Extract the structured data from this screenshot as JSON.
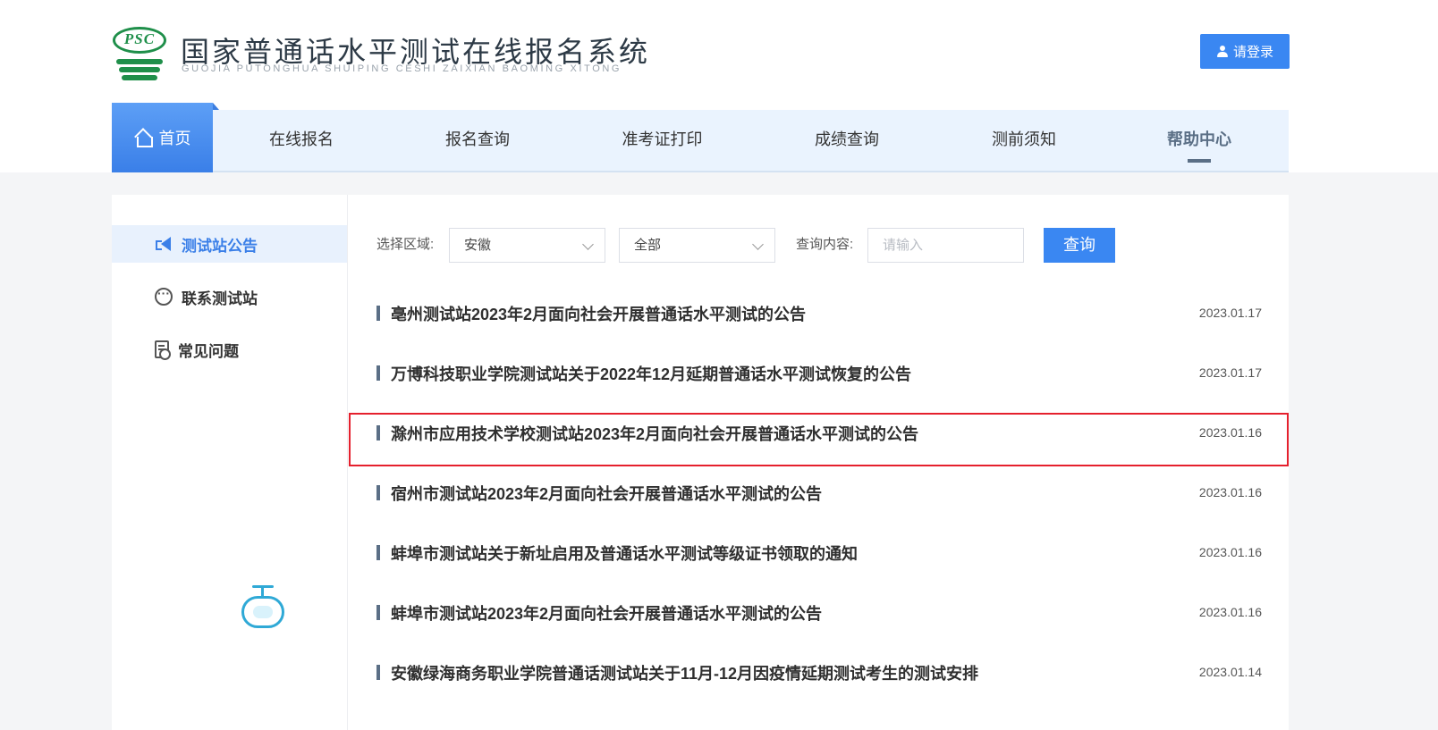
{
  "header": {
    "logo_text": "PSC",
    "site_title": "国家普通话水平测试在线报名系统",
    "site_pinyin": "GUOJIA PUTONGHUA SHUIPING CESHI ZAIXIAN BAOMING XITONG",
    "login_label": "请登录"
  },
  "nav": {
    "items": [
      {
        "label": "首页"
      },
      {
        "label": "在线报名"
      },
      {
        "label": "报名查询"
      },
      {
        "label": "准考证打印"
      },
      {
        "label": "成绩查询"
      },
      {
        "label": "测前须知"
      },
      {
        "label": "帮助中心"
      }
    ],
    "active_index": 6
  },
  "sidebar": {
    "items": [
      {
        "label": "测试站公告",
        "icon": "megaphone-icon"
      },
      {
        "label": "联系测试站",
        "icon": "chat-icon"
      },
      {
        "label": "常见问题",
        "icon": "document-icon"
      }
    ],
    "active_index": 0
  },
  "filters": {
    "region_label": "选择区域:",
    "region_value": "安徽",
    "scope_value": "全部",
    "query_label": "查询内容:",
    "query_placeholder": "请输入",
    "search_button": "查询"
  },
  "news": [
    {
      "title": "亳州测试站2023年2月面向社会开展普通话水平测试的公告",
      "date": "2023.01.17"
    },
    {
      "title": "万博科技职业学院测试站关于2022年12月延期普通话水平测试恢复的公告",
      "date": "2023.01.17"
    },
    {
      "title": "滁州市应用技术学校测试站2023年2月面向社会开展普通话水平测试的公告",
      "date": "2023.01.16"
    },
    {
      "title": "宿州市测试站2023年2月面向社会开展普通话水平测试的公告",
      "date": "2023.01.16"
    },
    {
      "title": "蚌埠市测试站关于新址启用及普通话水平测试等级证书领取的通知",
      "date": "2023.01.16"
    },
    {
      "title": "蚌埠市测试站2023年2月面向社会开展普通话水平测试的公告",
      "date": "2023.01.16"
    },
    {
      "title": "安徽绿海商务职业学院普通话测试站关于11月-12月因疫情延期测试考生的测试安排",
      "date": "2023.01.14"
    }
  ],
  "colors": {
    "brand_green": "#1f8f4a",
    "primary_blue": "#3a87f2",
    "nav_bg": "#eaf3fe",
    "highlight_red": "#e5202d"
  }
}
